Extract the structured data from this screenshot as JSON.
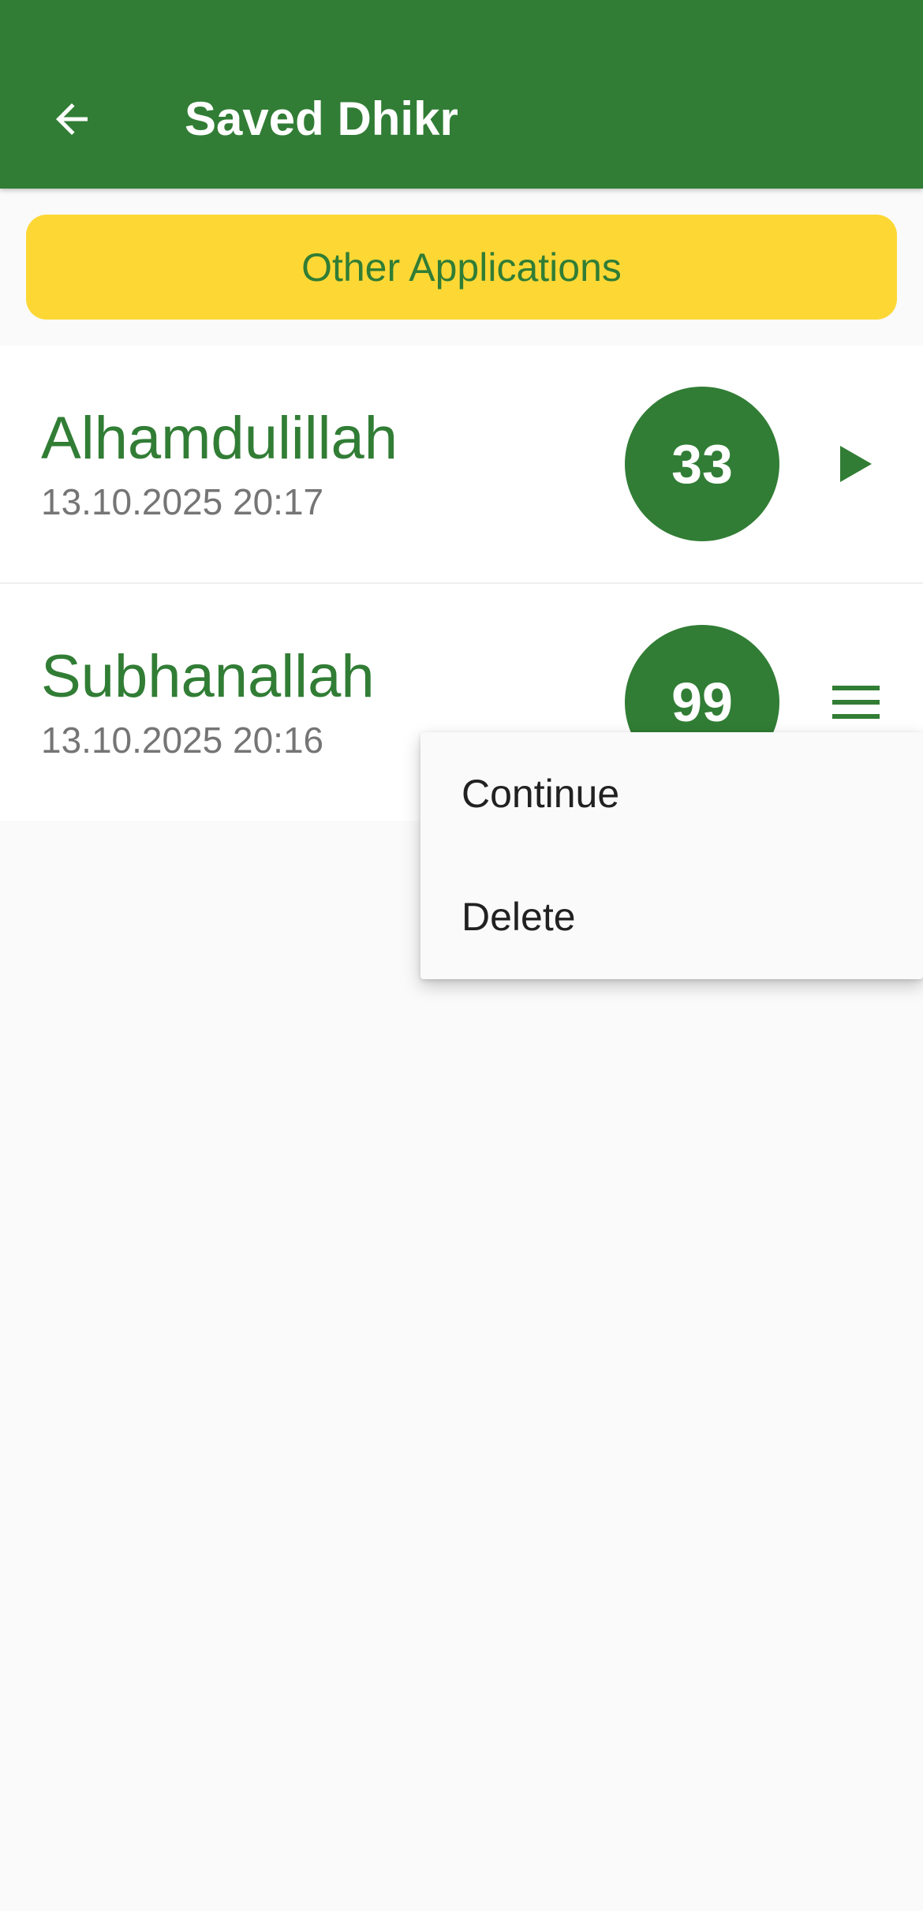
{
  "app_bar": {
    "title": "Saved Dhikr",
    "back_icon": "arrow-left-icon",
    "background_color": "#317d35"
  },
  "banner": {
    "label": "Other Applications",
    "background_color": "#fdd835"
  },
  "items": [
    {
      "title": "Alhamdulillah",
      "date": "13.10.2025 20:17",
      "count": "33",
      "action_icon": "play-icon"
    },
    {
      "title": "Subhanallah",
      "date": "13.10.2025 20:16",
      "count": "99",
      "action_icon": "menu-icon"
    }
  ],
  "popup_menu": {
    "items": [
      "Continue",
      "Delete"
    ]
  }
}
